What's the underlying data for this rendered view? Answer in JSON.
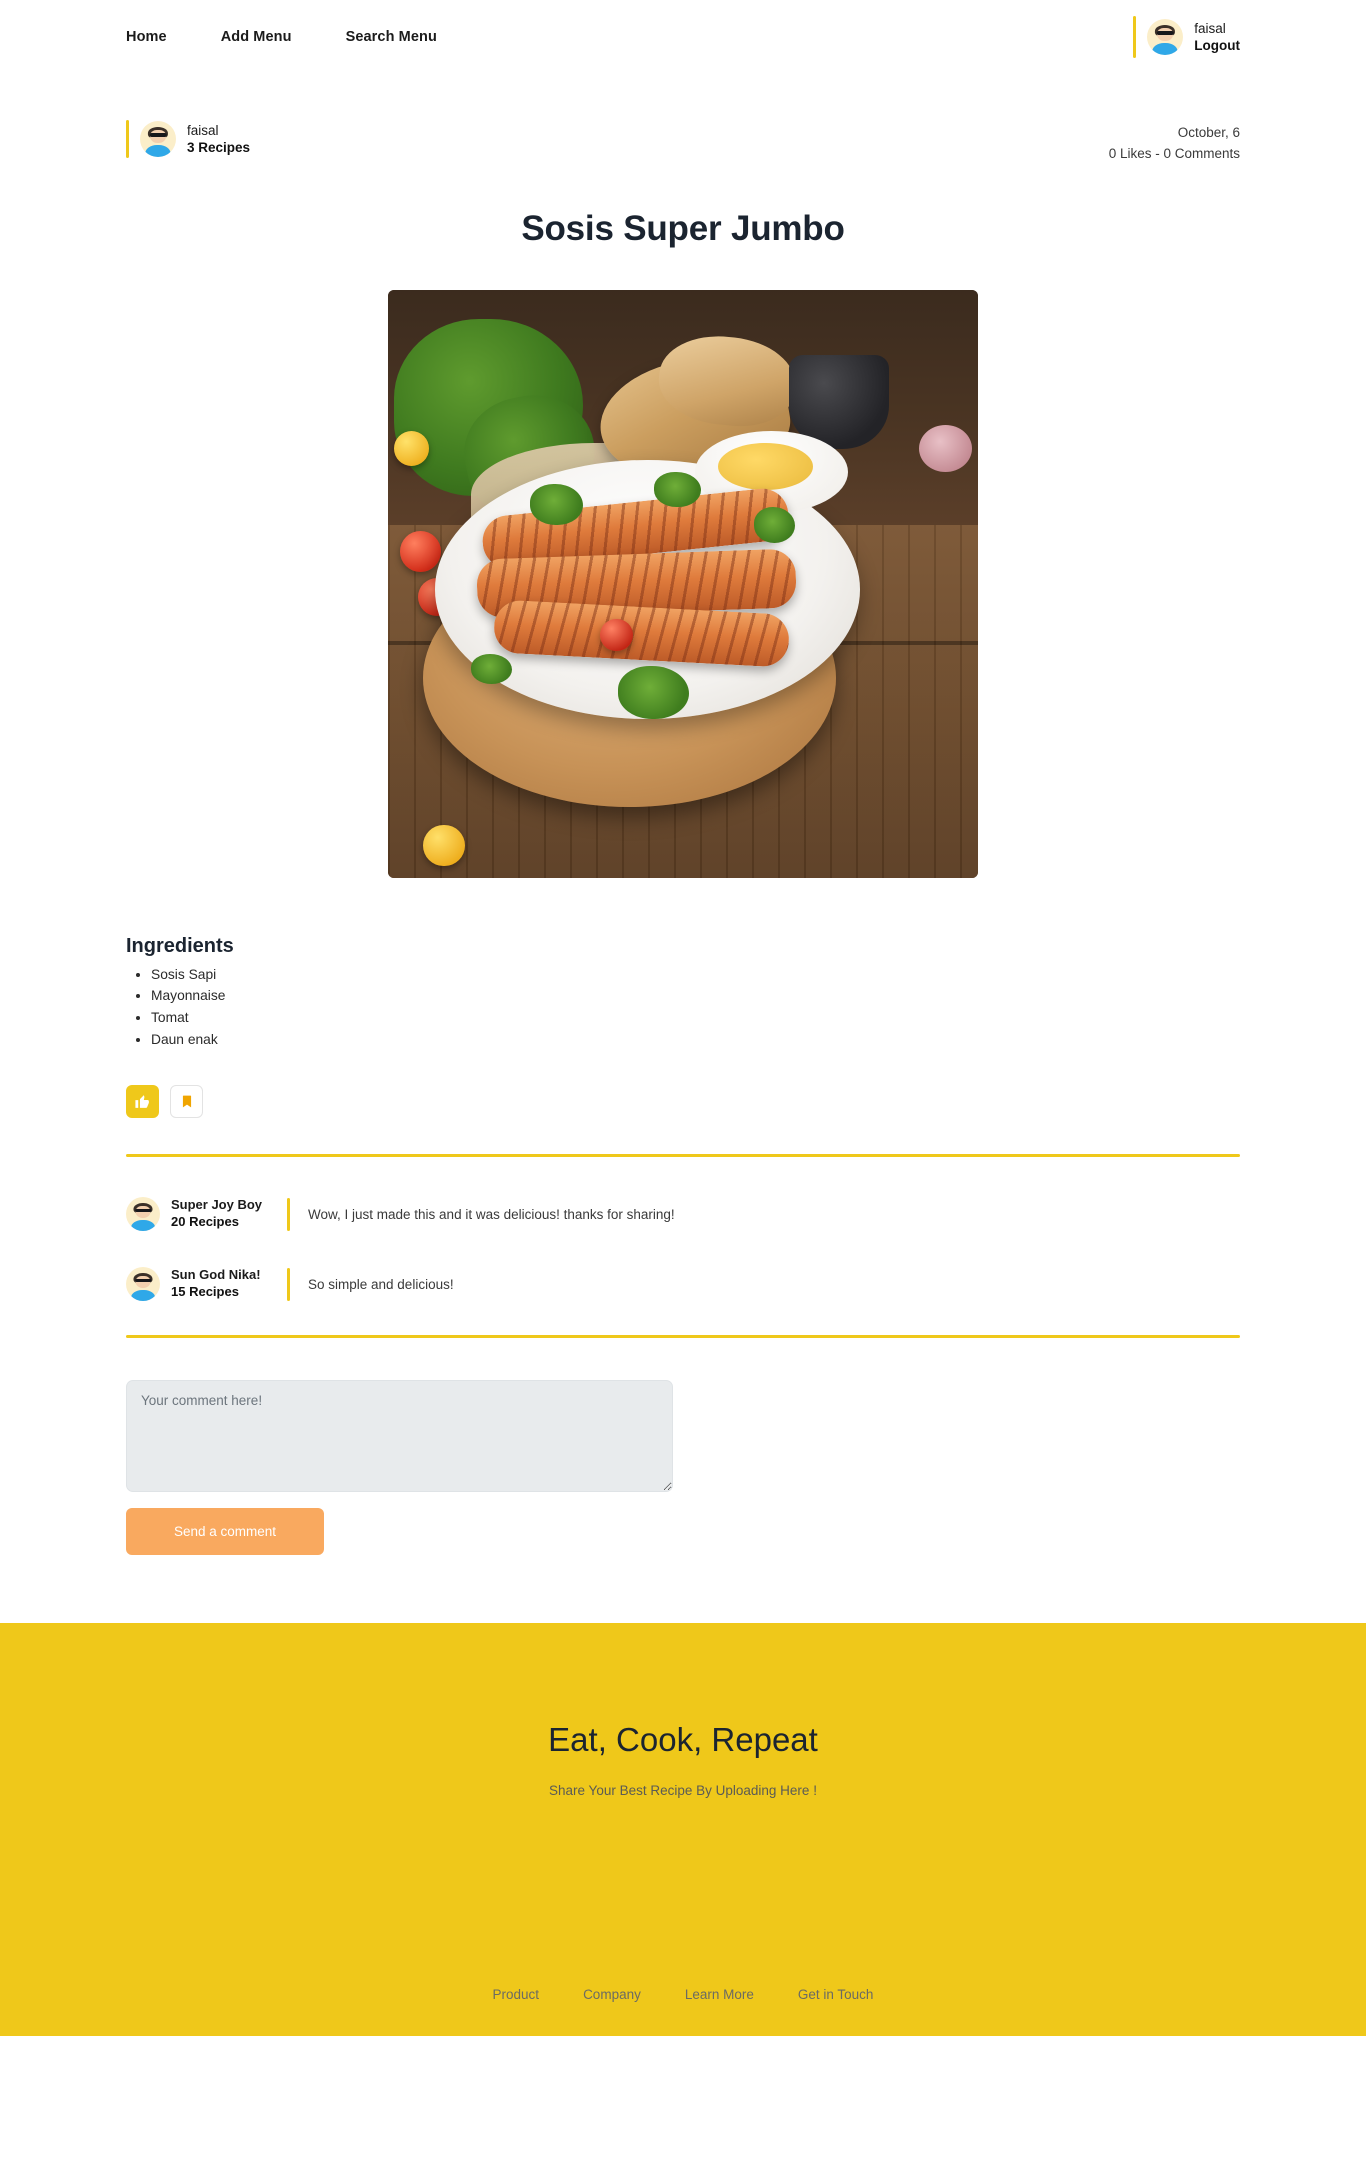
{
  "navbar": {
    "links": [
      {
        "label": "Home",
        "name": "nav-link-home"
      },
      {
        "label": "Add Menu",
        "name": "nav-link-add-menu"
      },
      {
        "label": "Search Menu",
        "name": "nav-link-search-menu"
      }
    ],
    "user": {
      "name": "faisal",
      "action": "Logout",
      "avatar_icon": "user-avatar-sunglasses-icon"
    }
  },
  "post": {
    "author": {
      "name": "faisal",
      "recipes": "3 Recipes",
      "avatar_icon": "user-avatar-sunglasses-icon"
    },
    "date": "October, 6",
    "stats": "0 Likes - 0 Comments",
    "title": "Sosis Super Jumbo",
    "image_alt": "sosis-super-jumbo-photo",
    "ingredients": {
      "heading": "Ingredients",
      "items": [
        "Sosis Sapi",
        "Mayonnaise",
        "Tomat",
        "Daun enak"
      ]
    },
    "actions": {
      "like_icon": "thumbs-up-icon",
      "save_icon": "bookmark-icon"
    }
  },
  "comments": [
    {
      "name": "Super Joy Boy",
      "recipes": "20 Recipes",
      "text": "Wow, I just made this and it was delicious! thanks for sharing!",
      "avatar_icon": "user-avatar-sunglasses-icon"
    },
    {
      "name": "Sun God Nika!",
      "recipes": "15 Recipes",
      "text": "So simple and delicious!",
      "avatar_icon": "user-avatar-sunglasses-icon"
    }
  ],
  "comment_form": {
    "placeholder": "Your comment here!",
    "value": "",
    "submit_label": "Send a comment"
  },
  "footer": {
    "title": "Eat, Cook, Repeat",
    "subtitle": "Share Your Best Recipe By Uploading Here !",
    "links": [
      "Product",
      "Company",
      "Learn More",
      "Get in Touch"
    ]
  },
  "colors": {
    "brand_yellow": "#efc81a",
    "accent_orange": "#f9a95f",
    "textarea_bg": "#e8ebed"
  }
}
